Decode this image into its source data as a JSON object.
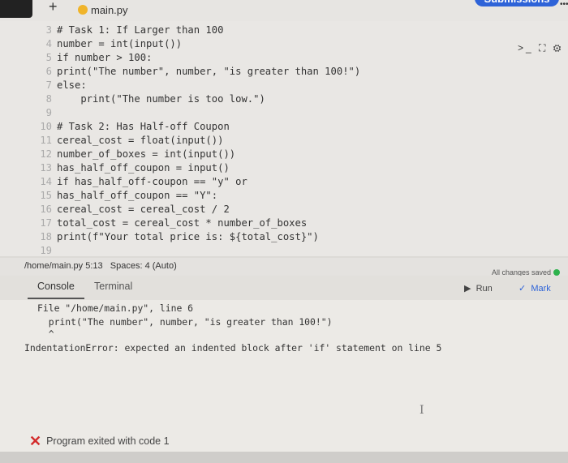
{
  "tabs": {
    "add_tab_icon": "plus-icon",
    "file_tab_label": "main.py",
    "submissions_label": "Submissions",
    "more_label": "•••"
  },
  "editor": {
    "tools_label": ">_ ⛶ ⚙",
    "lines": [
      {
        "num": "3",
        "code": "# Task 1: If Larger than 100"
      },
      {
        "num": "4",
        "code": "number = int(input())"
      },
      {
        "num": "5",
        "code": "if number > 100:"
      },
      {
        "num": "6",
        "code": "print(\"The number\", number, \"is greater than 100!\")"
      },
      {
        "num": "7",
        "code": "else:"
      },
      {
        "num": "8",
        "code": "    print(\"The number is too low.\")"
      },
      {
        "num": "9",
        "code": ""
      },
      {
        "num": "10",
        "code": "# Task 2: Has Half-off Coupon"
      },
      {
        "num": "11",
        "code": "cereal_cost = float(input())"
      },
      {
        "num": "12",
        "code": "number_of_boxes = int(input())"
      },
      {
        "num": "13",
        "code": "has_half_off_coupon = input()"
      },
      {
        "num": "14",
        "code": "if has_half_off-coupon == \"y\" or"
      },
      {
        "num": "15",
        "code": "has_half_off_coupon == \"Y\":"
      },
      {
        "num": "16",
        "code": "cereal_cost = cereal_cost / 2"
      },
      {
        "num": "17",
        "code": "total_cost = cereal_cost * number_of_boxes"
      },
      {
        "num": "18",
        "code": "print(f\"Your total price is: ${total_cost}\")"
      },
      {
        "num": "19",
        "code": ""
      }
    ]
  },
  "status": {
    "path_and_position": "/home/main.py 5:13",
    "indentation": "Spaces: 4 (Auto)",
    "saved": "All changes saved"
  },
  "console_tabs": {
    "console": "Console",
    "terminal": "Terminal",
    "run": "Run",
    "mark": "Mark"
  },
  "console": {
    "line1": "File \"/home/main.py\", line 6",
    "line2": "  print(\"The number\", number, \"is greater than 100!\")",
    "line3": "  ^",
    "error": "IndentationError: expected an indented block after 'if' statement on line 5",
    "exit_message": "Program exited with code 1",
    "cursor_glyph": "I"
  },
  "colors": {
    "accent_blue": "#2e63d8",
    "error_red": "#d32b2b",
    "saved_green": "#2db24c"
  }
}
